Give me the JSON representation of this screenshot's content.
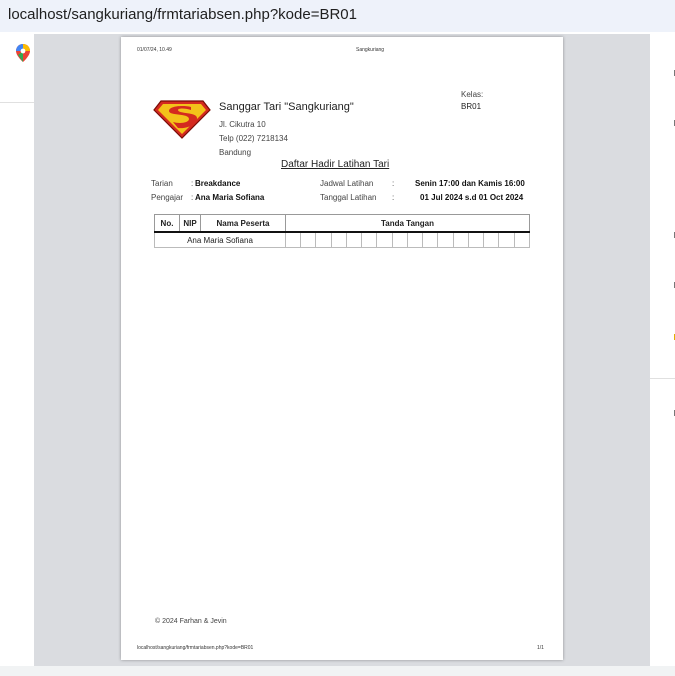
{
  "browser": {
    "url": "localhost/sangkuriang/frmtariabsen.php?kode=BR01"
  },
  "sidebar": {
    "icon": "google-maps-icon"
  },
  "print_header": {
    "datetime": "01/07/24, 10.49",
    "title": "Sangkuriang"
  },
  "org": {
    "name": "Sanggar Tari \"Sangkuriang\"",
    "street": "Jl. Cikutra 10",
    "phone": "Telp (022) 7218134",
    "city": "Bandung",
    "logo": "superman-logo"
  },
  "kelas": {
    "label": "Kelas:",
    "value": "BR01"
  },
  "document": {
    "title": "Daftar Hadir Latihan Tari"
  },
  "info": {
    "tarian_label": "Tarian",
    "tarian_value": "Breakdance",
    "pengajar_label": "Pengajar",
    "pengajar_value": "Ana Maria Sofiana",
    "jadwal_label": "Jadwal Latihan",
    "jadwal_value": "Senin 17:00 dan Kamis 16:00",
    "tanggal_label": "Tanggal Latihan",
    "tanggal_value": "01 Jul 2024 s.d 01 Oct 2024"
  },
  "table": {
    "headers": {
      "no": "No.",
      "nip": "NIP",
      "nama": "Nama Peserta",
      "tanda": "Tanda Tangan"
    },
    "rows": [
      {
        "no": "",
        "nip": "",
        "nama": "Ana Maria Sofiana"
      }
    ]
  },
  "footer": {
    "copyright": "© 2024 Farhan & Jevin"
  },
  "print_footer": {
    "url": "localhost/sangkuriang/frmtariabsen.php?kode=BR01",
    "page": "1/1"
  }
}
